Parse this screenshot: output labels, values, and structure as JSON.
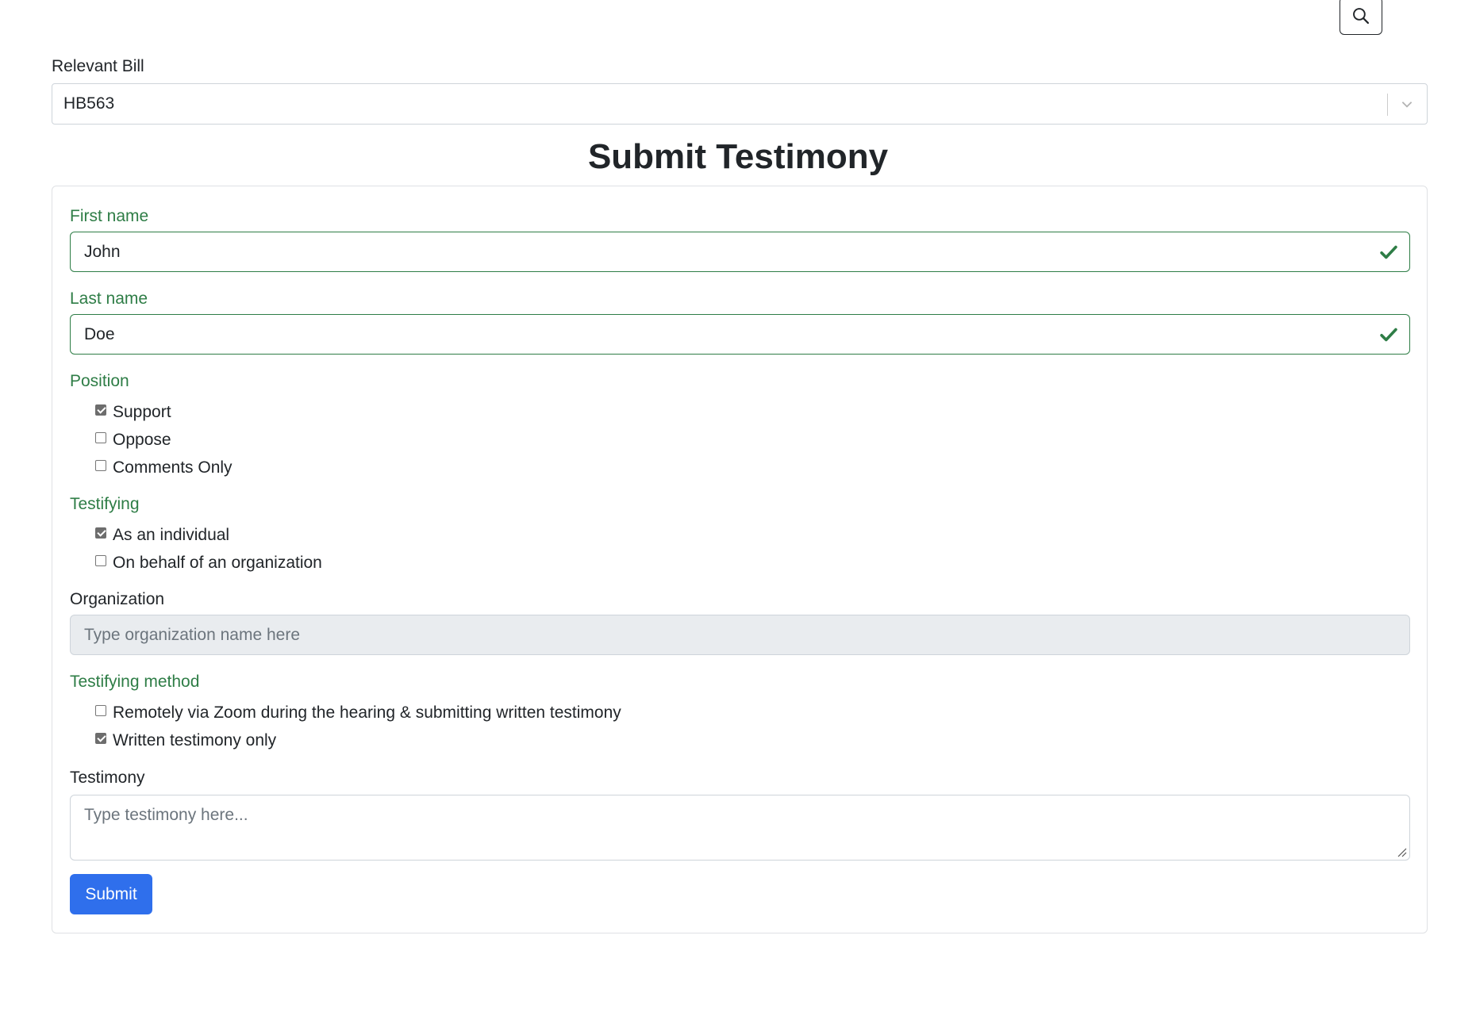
{
  "search": {
    "icon": "search-icon"
  },
  "bill": {
    "label": "Relevant Bill",
    "value": "HB563"
  },
  "title": "Submit Testimony",
  "form": {
    "first_name": {
      "label": "First name",
      "value": "John"
    },
    "last_name": {
      "label": "Last name",
      "value": "Doe"
    },
    "position": {
      "label": "Position",
      "options": [
        {
          "label": "Support",
          "checked": true
        },
        {
          "label": "Oppose",
          "checked": false
        },
        {
          "label": "Comments Only",
          "checked": false
        }
      ]
    },
    "testifying": {
      "label": "Testifying",
      "options": [
        {
          "label": "As an individual",
          "checked": true
        },
        {
          "label": "On behalf of an organization",
          "checked": false
        }
      ]
    },
    "organization": {
      "label": "Organization",
      "placeholder": "Type organization name here"
    },
    "method": {
      "label": "Testifying method",
      "options": [
        {
          "label": "Remotely via Zoom during the hearing & submitting written testimony",
          "checked": false
        },
        {
          "label": "Written testimony only",
          "checked": true
        }
      ]
    },
    "testimony": {
      "label": "Testimony",
      "placeholder": "Type testimony here..."
    },
    "submit_label": "Submit"
  },
  "colors": {
    "valid": "#2e7d46",
    "primary": "#2f6fec",
    "disabled_bg": "#e9ecef"
  }
}
